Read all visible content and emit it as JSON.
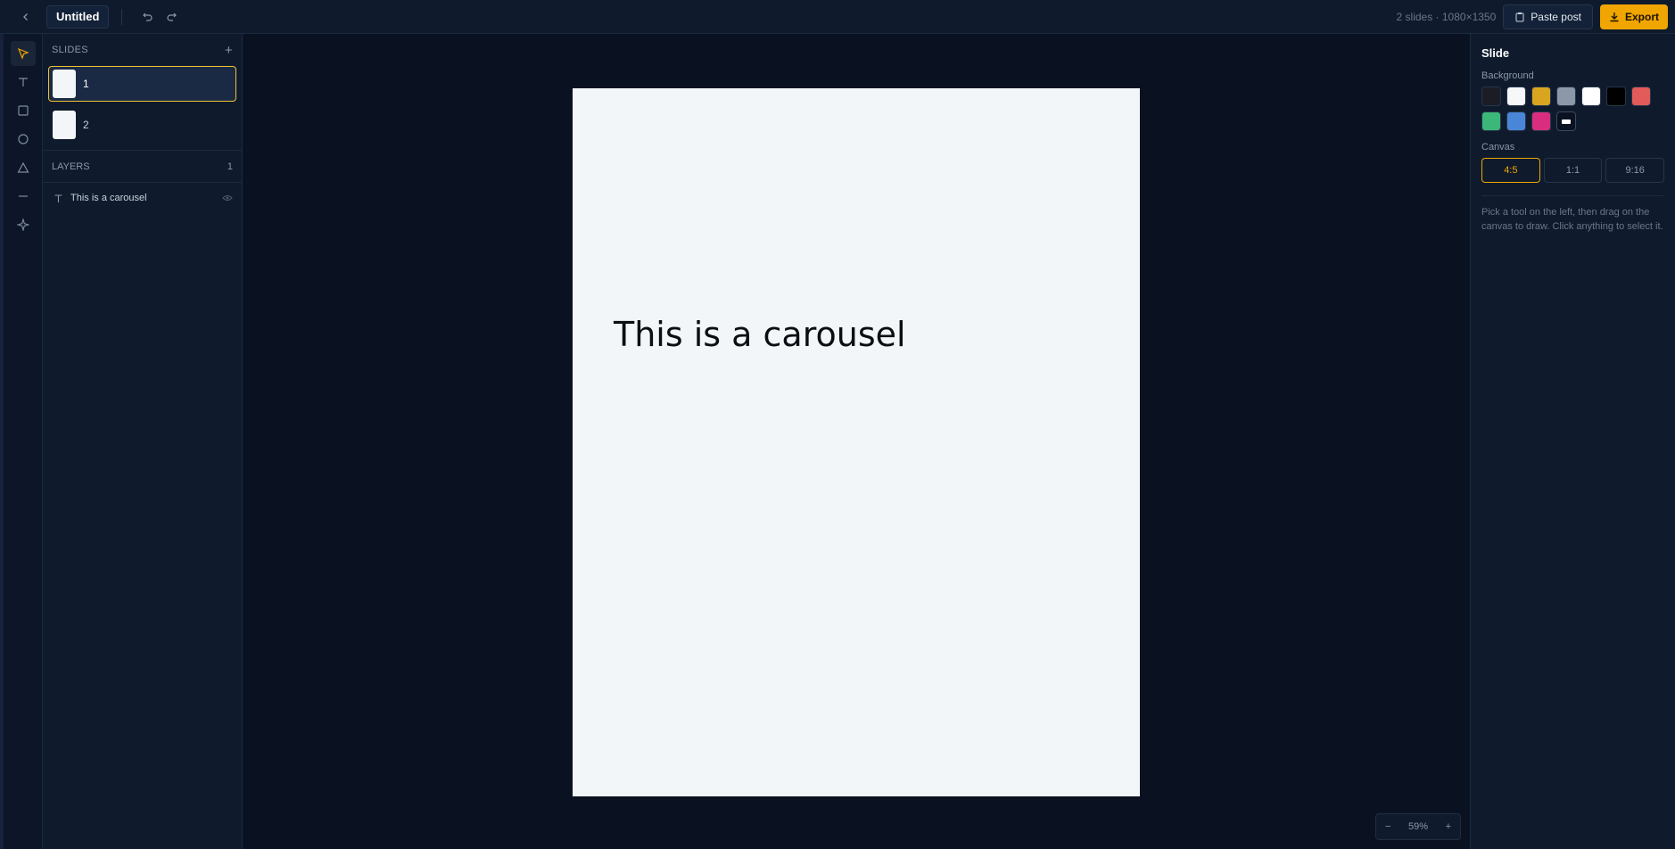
{
  "topbar": {
    "title": "Untitled",
    "meta": "2 slides · 1080×1350",
    "paste_label": "Paste post",
    "export_label": "Export"
  },
  "tools": [
    "select-tool",
    "text-tool",
    "rectangle-tool",
    "ellipse-tool",
    "triangle-tool",
    "line-tool",
    "sparkle-tool"
  ],
  "slides_panel": {
    "header": "SLIDES",
    "items": [
      {
        "label": "1"
      },
      {
        "label": "2"
      }
    ]
  },
  "layers_panel": {
    "header": "LAYERS",
    "count": "1",
    "items": [
      {
        "label": "This is a carousel"
      }
    ]
  },
  "canvas": {
    "text": "This is a carousel",
    "zoom": "59%",
    "zoom_minus": "−",
    "zoom_plus": "+"
  },
  "properties": {
    "title": "Slide",
    "background_label": "Background",
    "swatches": [
      "#1a1d23",
      "#f6f7f9",
      "#d9a520",
      "#8c97a8",
      "#ffffff",
      "#000000",
      "#e35a5a",
      "#3cb77a",
      "#4a86d8",
      "#d92e7f"
    ],
    "canvas_label": "Canvas",
    "canvas_options": [
      "4:5",
      "1:1",
      "9:16"
    ],
    "hint": "Pick a tool on the left, then drag on the canvas to draw. Click anything to select it."
  },
  "colors": {
    "accent": "#f0a500",
    "bg": "#0a1222",
    "panel": "#0f1b2d"
  }
}
